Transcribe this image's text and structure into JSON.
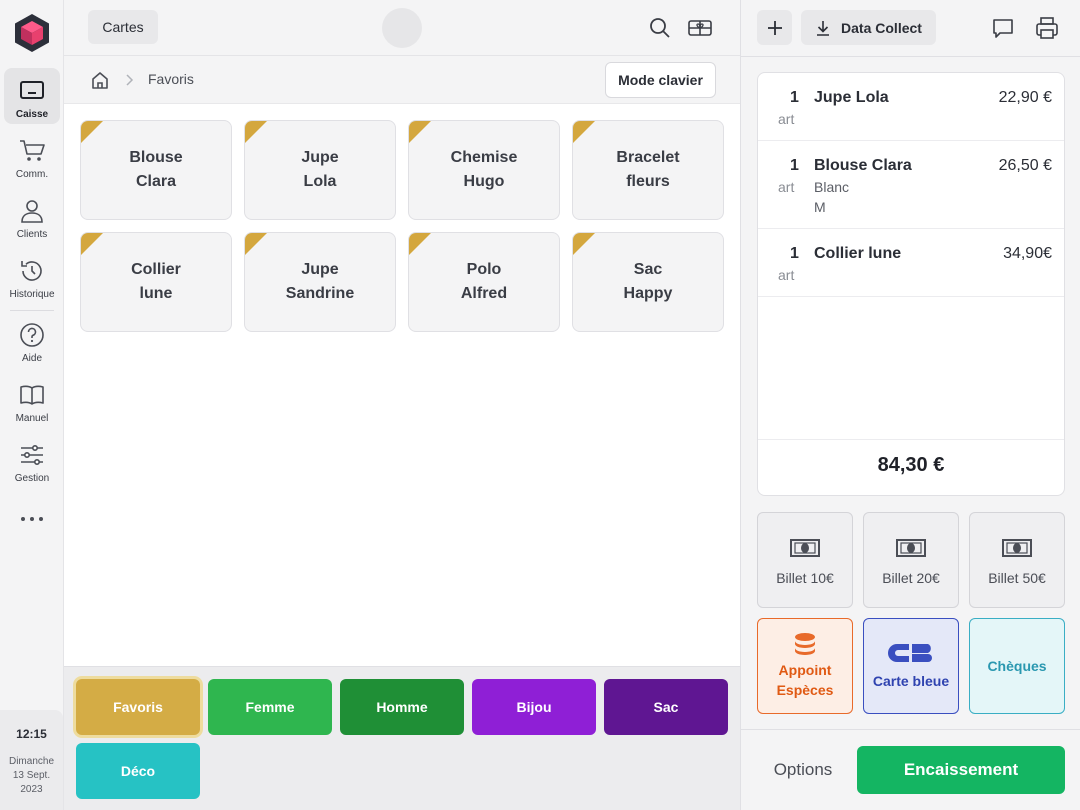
{
  "nav": {
    "logo": "cube-logo",
    "items": [
      {
        "label": "Caisse",
        "icon": "register-icon",
        "active": true
      },
      {
        "label": "Comm.",
        "icon": "cart-icon"
      },
      {
        "label": "Clients",
        "icon": "user-icon"
      },
      {
        "label": "Historique",
        "icon": "history-icon"
      },
      {
        "label": "Aide",
        "icon": "help-icon"
      },
      {
        "label": "Manuel",
        "icon": "book-icon"
      },
      {
        "label": "Gestion",
        "icon": "sliders-icon"
      }
    ],
    "more_icon": "more-dots-icon"
  },
  "clock": {
    "time": "12:15",
    "day": "Dimanche",
    "date": "13 Sept.",
    "year": "2023"
  },
  "topbar": {
    "cartes_label": "Cartes",
    "icons": [
      "search-icon",
      "gift-card-icon"
    ]
  },
  "breadcrumb": {
    "current": "Favoris",
    "keyboard_label": "Mode clavier"
  },
  "products": [
    {
      "name": "Blouse\nClara"
    },
    {
      "name": "Jupe\nLola"
    },
    {
      "name": "Chemise\nHugo"
    },
    {
      "name": "Bracelet\nfleurs"
    },
    {
      "name": "Collier\nlune"
    },
    {
      "name": "Jupe\nSandrine"
    },
    {
      "name": "Polo\nAlfred"
    },
    {
      "name": "Sac\nHappy"
    }
  ],
  "categories": [
    {
      "label": "Favoris",
      "color": "#d4ac45",
      "selected": true
    },
    {
      "label": "Femme",
      "color": "#2fb64f"
    },
    {
      "label": "Homme",
      "color": "#1f8f36"
    },
    {
      "label": "Bijou",
      "color": "#8f1fd6"
    },
    {
      "label": "Sac",
      "color": "#5f1692"
    },
    {
      "label": "Déco",
      "color": "#26c2c4"
    }
  ],
  "right_top": {
    "collect_label": "Data Collect",
    "icons": [
      "chat-icon",
      "printer-icon"
    ]
  },
  "cart": {
    "lines": [
      {
        "qty": "1",
        "unit": "art",
        "name": "Jupe Lola",
        "price": "22,90 €",
        "variants": []
      },
      {
        "qty": "1",
        "unit": "art",
        "name": "Blouse Clara",
        "price": "26,50 €",
        "variants": [
          "Blanc",
          "M"
        ]
      },
      {
        "qty": "1",
        "unit": "art",
        "name": "Collier lune",
        "price": "34,90€",
        "variants": []
      }
    ],
    "total": "84,30 €"
  },
  "payments": {
    "bills": [
      "Billet 10€",
      "Billet 20€",
      "Billet 50€"
    ],
    "cash": "Appoint\nEspèces",
    "card": "Carte bleue",
    "cheque": "Chèques"
  },
  "footer": {
    "options_label": "Options",
    "checkout_label": "Encaissement"
  },
  "colors": {
    "accent_green": "#14b562",
    "favorite_corner": "#d4a73e"
  }
}
